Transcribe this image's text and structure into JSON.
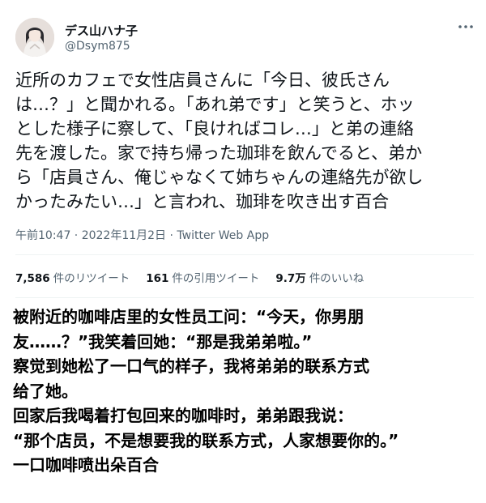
{
  "tweet": {
    "display_name": "デス山ハナ子",
    "handle": "@Dsym875",
    "more_icon": "more-horizontal-icon",
    "body_lines": [
      "近所のカフェで女性店員さんに「今日、彼氏さん",
      "は…？」と聞かれる。「あれ弟です」と笑うと、ホッ",
      "とした様子に察して、「良ければコレ…」と弟の連絡",
      "先を渡した。家で持ち帰った珈琲を飲んでると、弟か",
      "ら「店員さん、俺じゃなくて姉ちゃんの連絡先が欲し",
      "かったみたい…」と言われ、珈琲を吹き出す百合"
    ],
    "timestamp": "午前10:47 · 2022年11月2日 · Twitter Web App",
    "stats": {
      "retweets_count": "7,586",
      "retweets_label": "件のリツイート",
      "quotes_count": "161",
      "quotes_label": "件の引用ツイート",
      "likes_count": "9.7万",
      "likes_label": "件のいいね"
    }
  },
  "translation": {
    "lines": [
      "被附近的咖啡店里的女性员工问：“今天，你男朋",
      "友……？”我笑着回她：“那是我弟弟啦。”",
      "察觉到她松了一口气的样子，我将弟弟的联系方式",
      "给了她。",
      "回家后我喝着打包回来的咖啡时，弟弟跟我说：",
      "“那个店员，不是想要我的联系方式，人家想要你的。”",
      "一口咖啡喷出朵百合"
    ]
  }
}
